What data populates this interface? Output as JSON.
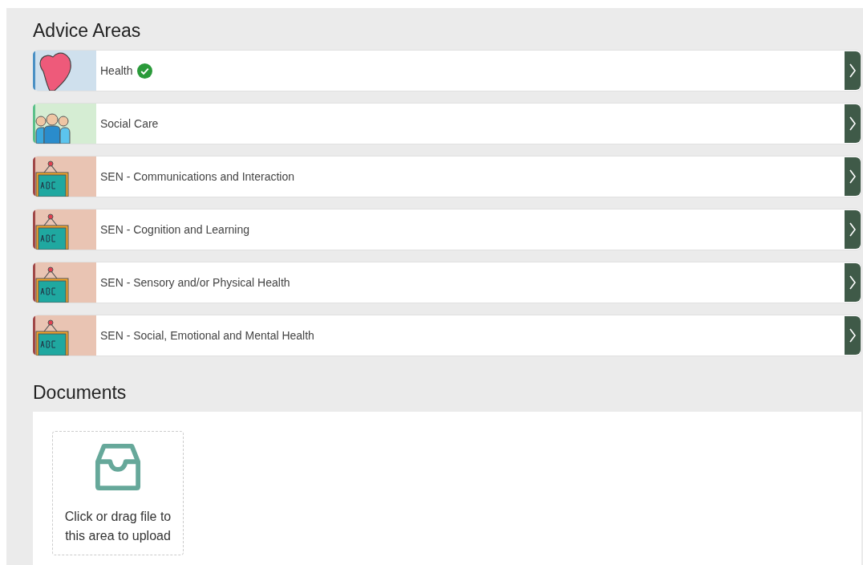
{
  "advice_areas": {
    "title": "Advice Areas",
    "items": [
      {
        "label": "Health",
        "kind": "heart",
        "color": "#cfe0ed",
        "completed": true
      },
      {
        "label": "Social Care",
        "kind": "people",
        "color": "#d5edd3",
        "completed": false
      },
      {
        "label": "SEN - Communications and Interaction",
        "kind": "board",
        "color": "#e9c4b3",
        "completed": false
      },
      {
        "label": "SEN - Cognition and Learning",
        "kind": "board",
        "color": "#e9c4b3",
        "completed": false
      },
      {
        "label": "SEN - Sensory and/or Physical Health",
        "kind": "board",
        "color": "#e9c4b3",
        "completed": false
      },
      {
        "label": "SEN - Social, Emotional and Mental Health",
        "kind": "board",
        "color": "#e9c4b3",
        "completed": false
      }
    ]
  },
  "documents": {
    "title": "Documents",
    "upload_hint": "Click or drag file to this area to upload"
  }
}
